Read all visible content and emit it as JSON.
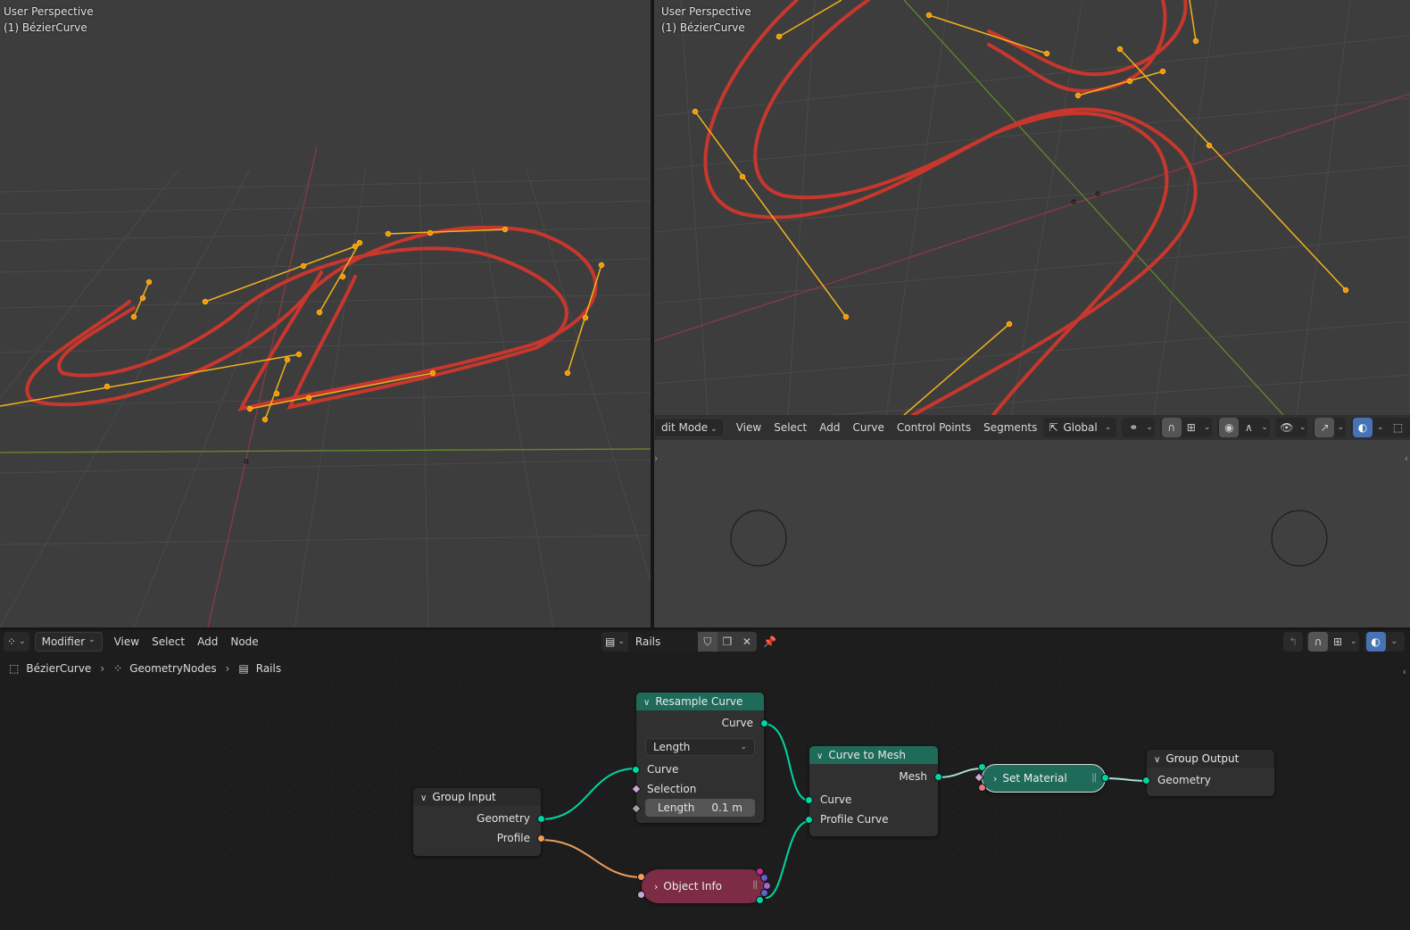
{
  "viewport_left": {
    "perspective": "User Perspective",
    "object": "(1) BézierCurve"
  },
  "viewport_right": {
    "perspective": "User Perspective",
    "object": "(1) BézierCurve"
  },
  "viewport_header": {
    "mode": "dit Mode",
    "menus": [
      "View",
      "Select",
      "Add",
      "Curve",
      "Control Points",
      "Segments"
    ],
    "transform_orientation": "Global",
    "icons": [
      "orientation-icon",
      "pivot-link-icon",
      "snap-magnet-icon",
      "snap-increment-icon",
      "proportional-edit-icon",
      "falloff-curve-icon",
      "visibility-eye-icon",
      "gizmo-icon",
      "overlay-icon",
      "xray-icon"
    ]
  },
  "node_editor": {
    "editor_type_icon": "geometry-nodes-icon",
    "context": "Modifier",
    "menus": [
      "View",
      "Select",
      "Add",
      "Node"
    ],
    "node_group_name": "Rails",
    "breadcrumb": [
      {
        "label": "BézierCurve",
        "icon": "object-icon"
      },
      {
        "label": "GeometryNodes",
        "icon": "geometry-nodes-icon"
      },
      {
        "label": "Rails",
        "icon": "node-tree-icon"
      }
    ],
    "nodes": {
      "group_input": {
        "title": "Group Input",
        "outputs": [
          "Geometry",
          "Profile"
        ]
      },
      "resample_curve": {
        "title": "Resample Curve",
        "output": "Curve",
        "mode": "Length",
        "inputs": [
          "Curve",
          "Selection"
        ],
        "length_label": "Length",
        "length_value": "0.1 m"
      },
      "object_info": {
        "title": "Object Info"
      },
      "curve_to_mesh": {
        "title": "Curve to Mesh",
        "output": "Mesh",
        "inputs": [
          "Curve",
          "Profile Curve"
        ]
      },
      "set_material": {
        "title": "Set Material"
      },
      "group_output": {
        "title": "Group Output",
        "inputs": [
          "Geometry"
        ]
      }
    }
  },
  "colors": {
    "geometry_socket": "#00d6a3",
    "object_socket": "#ed9e5c",
    "geometry_node_header": "#1f6b5a",
    "object_info_node": "#7d2c45",
    "curve_red": "#c8372d",
    "handle_yellow": "#f0b400",
    "active_blue": "#4772b3"
  }
}
